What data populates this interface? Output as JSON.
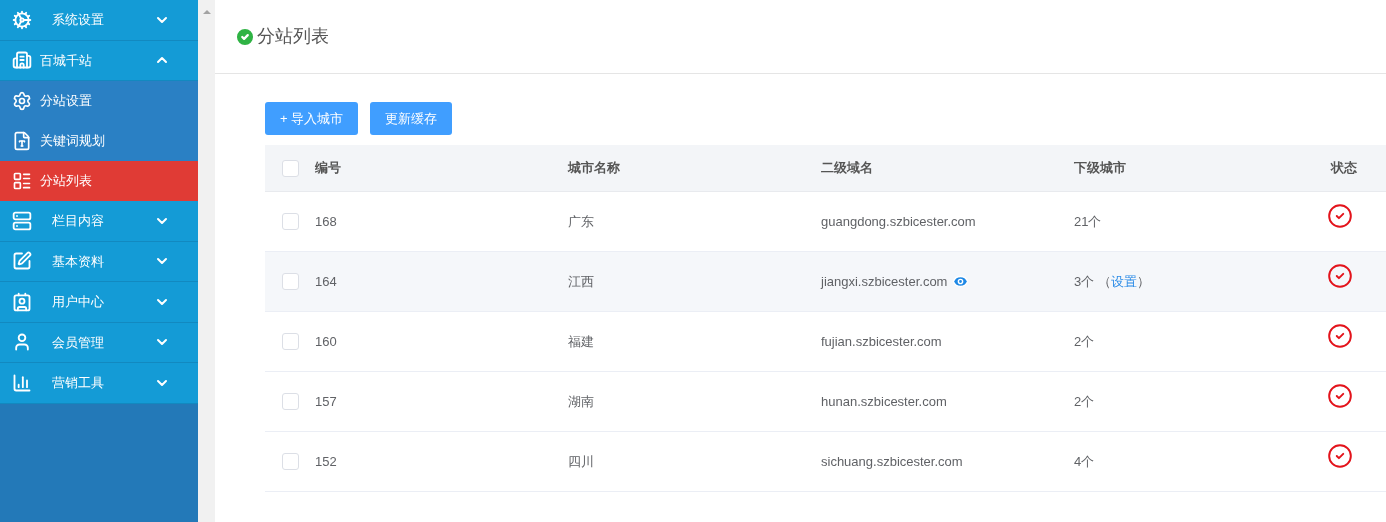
{
  "sidebar": {
    "items": [
      {
        "label": "系统设置",
        "expanded": false
      },
      {
        "label": "百城千站",
        "expanded": true,
        "children": [
          {
            "label": "分站设置",
            "selected": false
          },
          {
            "label": "关键词规划",
            "selected": false
          },
          {
            "label": "分站列表",
            "selected": true
          }
        ]
      },
      {
        "label": "栏目内容",
        "expanded": false
      },
      {
        "label": "基本资料",
        "expanded": false
      },
      {
        "label": "用户中心",
        "expanded": false
      },
      {
        "label": "会员管理",
        "expanded": false
      },
      {
        "label": "营销工具",
        "expanded": false
      }
    ]
  },
  "page": {
    "title": "分站列表"
  },
  "toolbar": {
    "buttons": [
      "+ 导入城市",
      "更新缓存"
    ]
  },
  "table": {
    "select_all": {
      "checked": false
    },
    "columns": [
      "编号",
      "城市名称",
      "二级域名",
      "下级城市",
      "状态"
    ],
    "rows": [
      {
        "id": "168",
        "city": "广东",
        "domain": "guangdong.szbicester.com",
        "preview": false,
        "sub_count": "21个",
        "sub_link": null,
        "enabled": true,
        "hovered": false,
        "checked": false
      },
      {
        "id": "164",
        "city": "江西",
        "domain": "jiangxi.szbicester.com",
        "preview": true,
        "sub_count": "3个",
        "sub_link": {
          "open": "（",
          "label": "设置",
          "close": "）"
        },
        "enabled": true,
        "hovered": true,
        "checked": false
      },
      {
        "id": "160",
        "city": "福建",
        "domain": "fujian.szbicester.com",
        "preview": false,
        "sub_count": "2个",
        "sub_link": null,
        "enabled": true,
        "hovered": false,
        "checked": false
      },
      {
        "id": "157",
        "city": "湖南",
        "domain": "hunan.szbicester.com",
        "preview": false,
        "sub_count": "2个",
        "sub_link": null,
        "enabled": true,
        "hovered": false,
        "checked": false
      },
      {
        "id": "152",
        "city": "四川",
        "domain": "sichuang.szbicester.com",
        "preview": false,
        "sub_count": "4个",
        "sub_link": null,
        "enabled": true,
        "hovered": false,
        "checked": false
      }
    ]
  }
}
